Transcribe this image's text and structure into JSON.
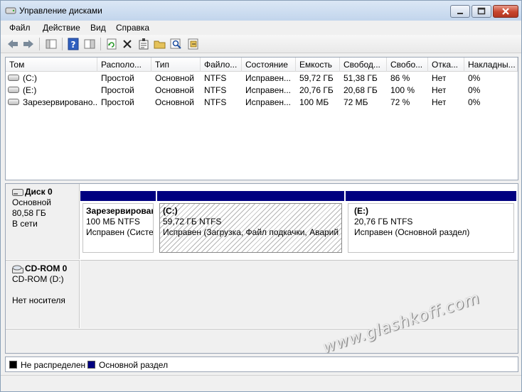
{
  "window": {
    "title": "Управление дисками",
    "icon": "disk-management-icon"
  },
  "menu": [
    "Файл",
    "Действие",
    "Вид",
    "Справка"
  ],
  "toolbar": {
    "icons": [
      "back-arrow-icon",
      "forward-arrow-icon",
      "console-tree-icon",
      "help-icon",
      "action-pane-icon",
      "refresh-icon",
      "delete-icon",
      "properties-icon",
      "open-folder-icon",
      "search-icon",
      "export-icon"
    ]
  },
  "volume_list": {
    "columns": [
      "Том",
      "Располо...",
      "Тип",
      "Файло...",
      "Состояние",
      "Емкость",
      "Свобод...",
      "Свобо...",
      "Отка...",
      "Накладны..."
    ],
    "rows": [
      [
        "(C:)",
        "Простой",
        "Основной",
        "NTFS",
        "Исправен...",
        "59,72 ГБ",
        "51,38 ГБ",
        "86 %",
        "Нет",
        "0%"
      ],
      [
        "(E:)",
        "Простой",
        "Основной",
        "NTFS",
        "Исправен...",
        "20,76 ГБ",
        "20,68 ГБ",
        "100 %",
        "Нет",
        "0%"
      ],
      [
        "Зарезервировано...",
        "Простой",
        "Основной",
        "NTFS",
        "Исправен...",
        "100 МБ",
        "72 МБ",
        "72 %",
        "Нет",
        "0%"
      ]
    ]
  },
  "disks": [
    {
      "name": "Диск 0",
      "type": "Основной",
      "size": "80,58 ГБ",
      "status": "В сети",
      "partitions": [
        {
          "name": "Зарезервирован",
          "size": "100 МБ NTFS",
          "status": "Исправен (Систе"
        },
        {
          "name": "(C:)",
          "size": "59,72 ГБ NTFS",
          "status": "Исправен (Загрузка, Файл подкачки, Аварий"
        },
        {
          "name": "(E:)",
          "size": "20,76 ГБ NTFS",
          "status": "Исправен (Основной раздел)"
        }
      ]
    },
    {
      "name": "CD-ROM 0",
      "type": "CD-ROM (D:)",
      "status": "Нет носителя"
    }
  ],
  "legend": [
    {
      "label": "Не распределен",
      "color": "#000000"
    },
    {
      "label": "Основной раздел",
      "color": "#000080"
    }
  ],
  "watermark": "www.glashkoff.com"
}
